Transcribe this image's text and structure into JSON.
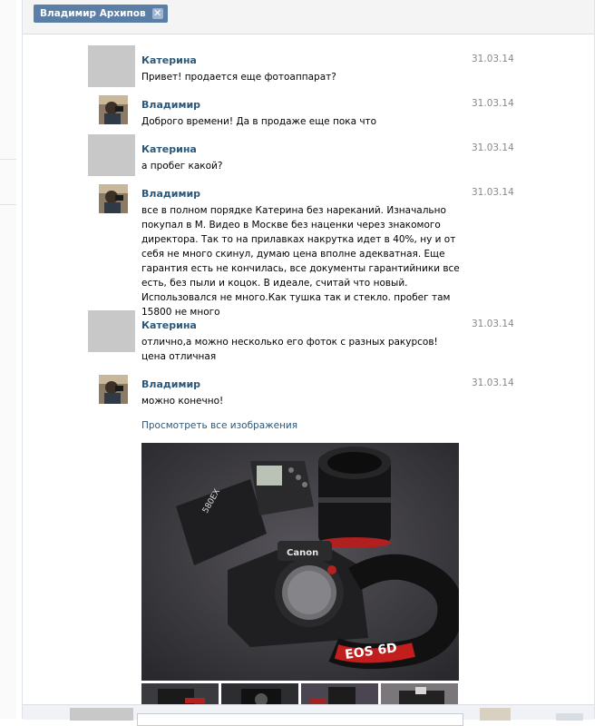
{
  "header": {
    "contact_name": "Владимир Архипов",
    "close_symbol": "✕"
  },
  "messages": [
    {
      "author": "Катерина",
      "date": "31.03.14",
      "text": "Привет! продается еще фотоаппарат?",
      "avatar": "placeholder"
    },
    {
      "author": "Владимир",
      "date": "31.03.14",
      "text": "Доброго времени! Да в продаже еще пока что",
      "avatar": "photo"
    },
    {
      "author": "Катерина",
      "date": "31.03.14",
      "text": "а пробег какой?",
      "avatar": "placeholder"
    },
    {
      "author": "Владимир",
      "date": "31.03.14",
      "text": "все в полном порядке Катерина без нареканий. Изначально покупал в М. Видео в Москве без наценки через знакомого директора. Так то на прилавках накрутка идет в 40%, ну и от себя не много скинул, думаю цена вполне адекватная. Еще гарантия есть не кончилась, все документы гарантийники все есть, без пыли и коцок. В идеале, считай что новый. Использовался не много.Как тушка так и стекло. пробег там 15800 не много",
      "avatar": "photo"
    },
    {
      "author": "Катерина",
      "date": "31.03.14",
      "text": "отлично,а можно несколько его фоток с разных ракурсов! цена отличная",
      "avatar": "placeholder"
    },
    {
      "author": "Владимир",
      "date": "31.03.14",
      "text": "можно конечно!",
      "avatar": "photo"
    }
  ],
  "attachments": {
    "view_all_label": "Просмотреть все изображения",
    "main_photo": {
      "camera_brand": "Canon",
      "strap_text": "EOS 6D",
      "flash_text": "580EX"
    }
  },
  "colors": {
    "link": "#2b587a",
    "chip": "#5b7ea7",
    "date": "#888888"
  }
}
